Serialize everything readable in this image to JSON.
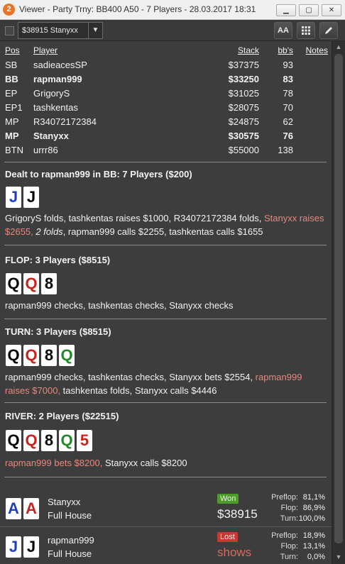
{
  "window": {
    "app_icon": "2",
    "title": "Viewer - Party Trny: BB400 A50 - 7 Players - 28.03.2017 18:31",
    "buttons": [
      "minimize-icon",
      "maximize-icon",
      "close-icon"
    ]
  },
  "toolbar": {
    "player_select": "$38915 Stanyxx",
    "font_button": "AA",
    "grid_icon": "grid-icon",
    "edit_icon": "pencil-icon"
  },
  "table": {
    "headers": {
      "pos": "Pos",
      "player": "Player",
      "stack": "Stack",
      "bbs": "bb's",
      "notes": "Notes"
    },
    "rows": [
      {
        "pos": "SB",
        "player": "sadieacesSP",
        "stack": "$37375",
        "bbs": "93",
        "bold": false
      },
      {
        "pos": "BB",
        "player": "rapman999",
        "stack": "$33250",
        "bbs": "83",
        "bold": true
      },
      {
        "pos": "EP",
        "player": "GrigoryS",
        "stack": "$31025",
        "bbs": "78",
        "bold": false
      },
      {
        "pos": "EP1",
        "player": "tashkentas",
        "stack": "$28075",
        "bbs": "70",
        "bold": false
      },
      {
        "pos": "MP",
        "player": "R34072172384",
        "stack": "$24875",
        "bbs": "62",
        "bold": false
      },
      {
        "pos": "MP",
        "player": "Stanyxx",
        "stack": "$30575",
        "bbs": "76",
        "bold": true
      },
      {
        "pos": "BTN",
        "player": "urrr86",
        "stack": "$55000",
        "bbs": "138",
        "bold": false
      }
    ]
  },
  "preflop": {
    "title": "Dealt to rapman999 in BB: 7 Players ($200)",
    "cards": [
      {
        "rank": "J",
        "color": "#1f3fbf"
      },
      {
        "rank": "J",
        "color": "#000000"
      }
    ],
    "action_parts": [
      {
        "text": "GrigoryS folds, tashkentas raises $1000, R34072172384 folds, ",
        "style": ""
      },
      {
        "text": "Stanyxx raises $2655, ",
        "style": "red"
      },
      {
        "text": "2 folds",
        "style": "ital"
      },
      {
        "text": ", rapman999 calls $2255, tashkentas calls $1655",
        "style": ""
      }
    ]
  },
  "flop": {
    "title": "FLOP: 3 Players ($8515)",
    "cards": [
      {
        "rank": "Q",
        "color": "#000000"
      },
      {
        "rank": "Q",
        "color": "#c8241d"
      },
      {
        "rank": "8",
        "color": "#000000"
      }
    ],
    "action": "rapman999 checks, tashkentas checks, Stanyxx checks"
  },
  "turn": {
    "title": "TURN: 3 Players ($8515)",
    "cards": [
      {
        "rank": "Q",
        "color": "#000000"
      },
      {
        "rank": "Q",
        "color": "#c8241d"
      },
      {
        "rank": "8",
        "color": "#000000"
      },
      {
        "rank": "Q",
        "color": "#1f8a2a"
      }
    ],
    "action_parts": [
      {
        "text": "rapman999 checks, tashkentas checks, Stanyxx bets $2554, ",
        "style": ""
      },
      {
        "text": "rapman999 raises $7000, ",
        "style": "red"
      },
      {
        "text": "tashkentas folds, Stanyxx calls $4446",
        "style": ""
      }
    ]
  },
  "river": {
    "title": "RIVER: 2 Players ($22515)",
    "cards": [
      {
        "rank": "Q",
        "color": "#000000"
      },
      {
        "rank": "Q",
        "color": "#c8241d"
      },
      {
        "rank": "8",
        "color": "#000000"
      },
      {
        "rank": "Q",
        "color": "#1f8a2a"
      },
      {
        "rank": "5",
        "color": "#c8241d"
      }
    ],
    "action_parts": [
      {
        "text": "rapman999 bets $8200, ",
        "style": "red"
      },
      {
        "text": "Stanyxx calls $8200",
        "style": ""
      }
    ]
  },
  "showdown": [
    {
      "player": "Stanyxx",
      "hand": "Full House",
      "cards": [
        {
          "rank": "A",
          "color": "#1f3fbf"
        },
        {
          "rank": "A",
          "color": "#c8241d"
        }
      ],
      "result": "Won",
      "amount": "$38915",
      "stats": [
        {
          "label": "Preflop:",
          "value": "81,1%"
        },
        {
          "label": "Flop:",
          "value": "86,9%"
        },
        {
          "label": "Turn:",
          "value": "100,0%"
        }
      ]
    },
    {
      "player": "rapman999",
      "hand": "Full House",
      "cards": [
        {
          "rank": "J",
          "color": "#1f3fbf"
        },
        {
          "rank": "J",
          "color": "#000000"
        }
      ],
      "result": "Lost",
      "amount": "shows",
      "stats": [
        {
          "label": "Preflop:",
          "value": "18,9%"
        },
        {
          "label": "Flop:",
          "value": "13,1%"
        },
        {
          "label": "Turn:",
          "value": "0,0%"
        }
      ]
    }
  ]
}
